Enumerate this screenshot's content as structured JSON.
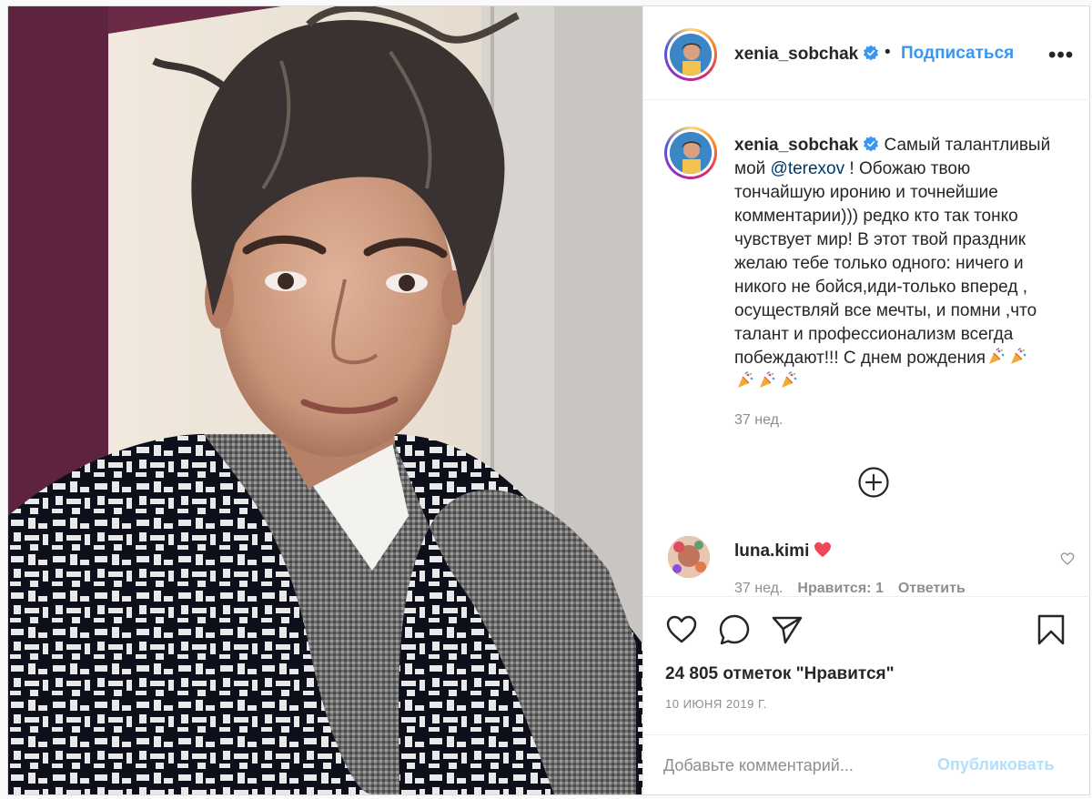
{
  "post": {
    "username": "xenia_sobchak",
    "verified": true,
    "follow_label": "Подписаться",
    "separator": "•",
    "more_label": "•••"
  },
  "caption": {
    "username": "xenia_sobchak",
    "text_before": "Самый талантливый мой",
    "mention": "@terexov",
    "text_after": "! Обожаю твою тончайшую иронию и точнейшие комментарии))) редко кто так тонко чувствует мир! В этот твой праздник желаю тебе только одного: ничего и никого не бойся,иди-только вперед , осуществляй все мечты, и помни ,что талант и профессионализм всегда побеждают!!! С днем рождения",
    "emoji": "party-popper",
    "time": "37 нед."
  },
  "comments": [
    {
      "username": "luna.kimi",
      "emoji": "red-heart",
      "time": "37 нед.",
      "likes_label": "Нравится: 1",
      "reply_label": "Ответить"
    }
  ],
  "stats": {
    "likes_text": "24 805 отметок \"Нравится\"",
    "date": "10 ИЮНЯ 2019 Г."
  },
  "composer": {
    "placeholder": "Добавьте комментарий...",
    "publish_label": "Опубликовать"
  },
  "colors": {
    "link": "#3897f0",
    "mention": "#00376b",
    "muted": "#8e8e8e",
    "publish_disabled": "#b2dffc",
    "heart": "#ed4956"
  },
  "icons": [
    "verified-badge-icon",
    "more-options-icon",
    "load-more-plus-icon",
    "comment-like-heart-icon",
    "like-heart-icon",
    "comment-bubble-icon",
    "share-paper-plane-icon",
    "save-bookmark-icon"
  ]
}
